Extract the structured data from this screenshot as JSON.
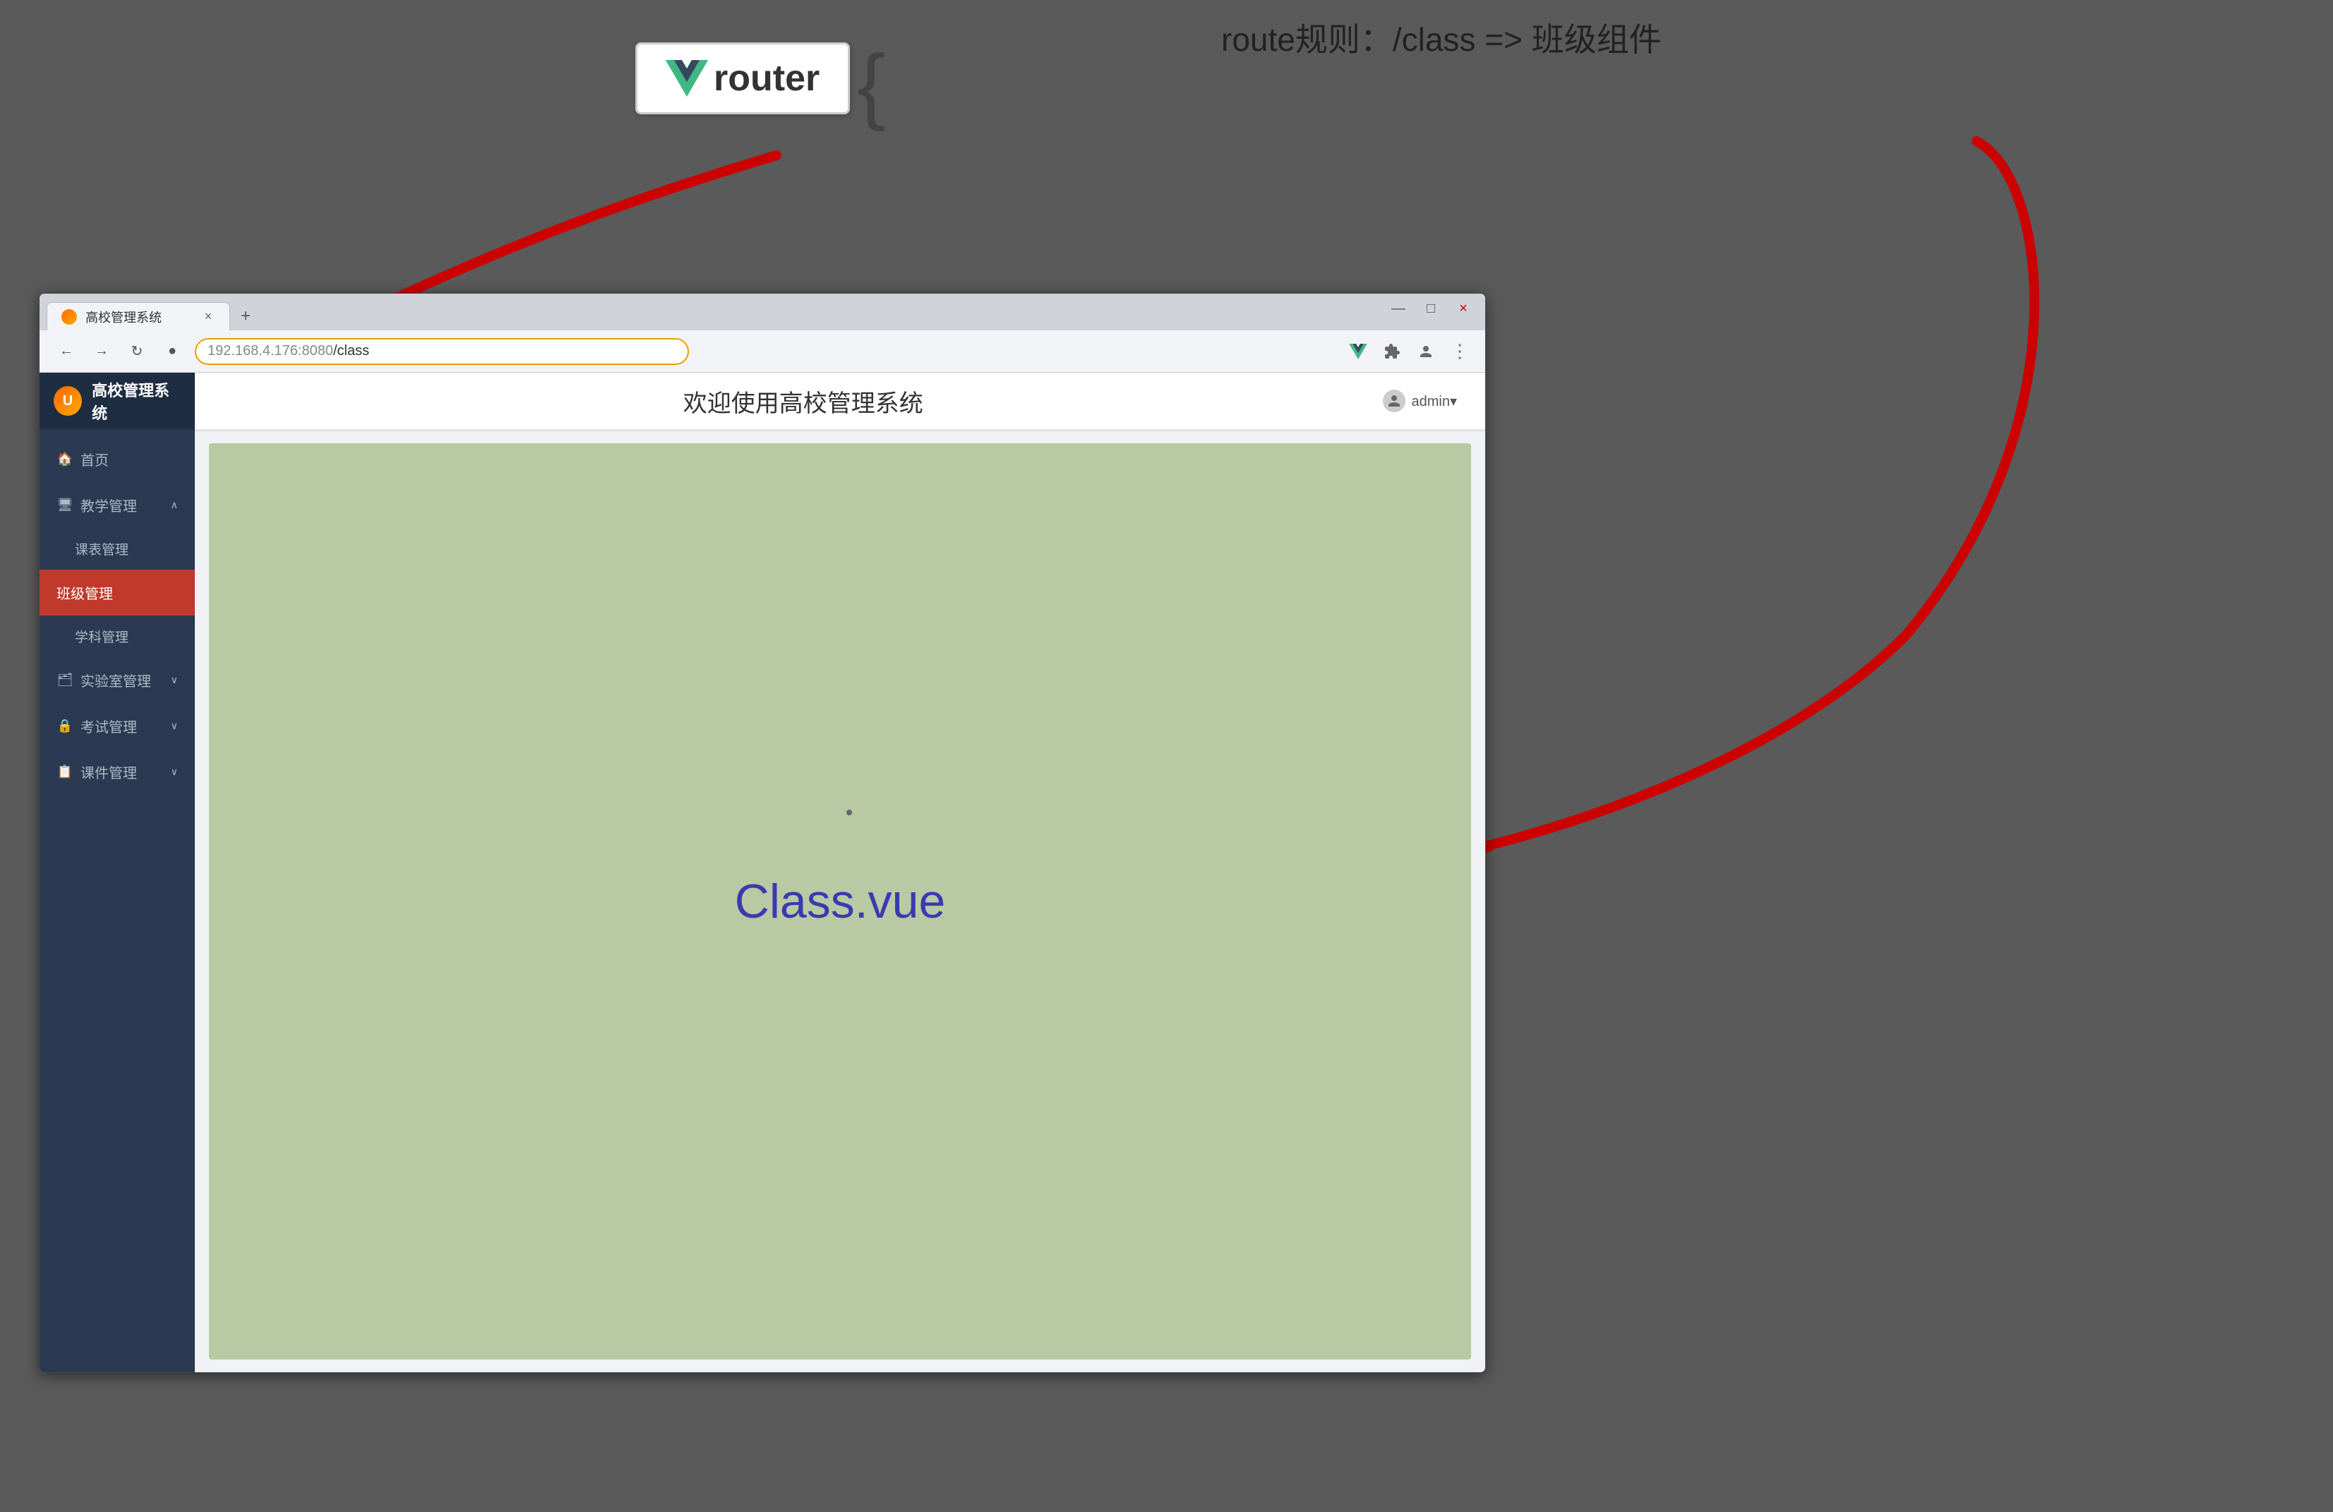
{
  "background": "#5a5a5a",
  "annotation": {
    "router_label": "router",
    "route_rule": "route规则：/class =>  班级组件"
  },
  "browser": {
    "tab_title": "高校管理系统",
    "tab_close": "×",
    "new_tab": "+",
    "address_domain": "192.168.4.176:8080",
    "address_path": "/class",
    "window_controls": {
      "minimize": "—",
      "maximize": "□",
      "close": "×"
    }
  },
  "app": {
    "header_title": "欢迎使用高校管理系统",
    "user_label": "admin▾",
    "sidebar": {
      "logo_text": "高校管理系统",
      "menu_items": [
        {
          "label": "首页",
          "icon": "🏠",
          "active": false,
          "has_sub": false
        },
        {
          "label": "教学管理",
          "icon": "🖥",
          "active": false,
          "has_sub": true,
          "expanded": true
        },
        {
          "label": "课表管理",
          "icon": "",
          "active": false,
          "is_sub": true
        },
        {
          "label": "班级管理",
          "icon": "",
          "active": true,
          "is_sub": true
        },
        {
          "label": "学科管理",
          "icon": "",
          "active": false,
          "is_sub": true
        },
        {
          "label": "实验室管理",
          "icon": "🗂",
          "active": false,
          "has_sub": true
        },
        {
          "label": "考试管理",
          "icon": "🔒",
          "active": false,
          "has_sub": true
        },
        {
          "label": "课件管理",
          "icon": "📋",
          "active": false,
          "has_sub": true
        }
      ]
    },
    "class_component_label": "Class.vue"
  }
}
